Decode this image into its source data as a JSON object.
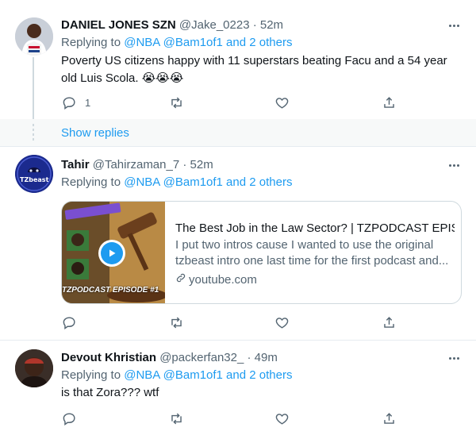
{
  "tweets": [
    {
      "name": "DANIEL JONES SZN",
      "meta": "@Jake_0223 · 52m",
      "replying_prefix": "Replying to ",
      "replying_mentions": "@NBA @Bam1of1 and 2 others",
      "text": "Poverty US citizens happy with 11 superstars beating Facu and a 54 year old Luis Scola. 😭😭😭",
      "reply_count": "1"
    },
    {
      "name": "Tahir",
      "meta": "@Tahirzaman_7 · 52m",
      "replying_prefix": "Replying to ",
      "replying_mentions": "@NBA @Bam1of1 and 2 others",
      "avatar_text": "TZbeast"
    },
    {
      "name": "Devout Khristian",
      "meta": "@packerfan32_ · 49m",
      "replying_prefix": "Replying to ",
      "replying_mentions": "@NBA @Bam1of1 and 2 others",
      "text": "is that Zora??? wtf"
    }
  ],
  "show_replies": "Show replies",
  "card": {
    "title": "The Best Job in the Law Sector? | TZPODCAST EPIS...",
    "description": "I put two intros cause I wanted to use the original tzbeast intro one last time for the first podcast and...",
    "domain": "youtube.com",
    "thumb_caption": "TZPODCAST EPISODE #1"
  },
  "icons": {
    "reply": "reply-icon",
    "retweet": "retweet-icon",
    "like": "like-icon",
    "share": "share-icon",
    "more": "more-icon",
    "play": "play-icon",
    "link": "link-icon"
  },
  "colors": {
    "accent": "#1d9bf0",
    "secondary_text": "#536471",
    "divider": "#e6ecf0",
    "show_replies_bg": "#f7f9f9"
  }
}
